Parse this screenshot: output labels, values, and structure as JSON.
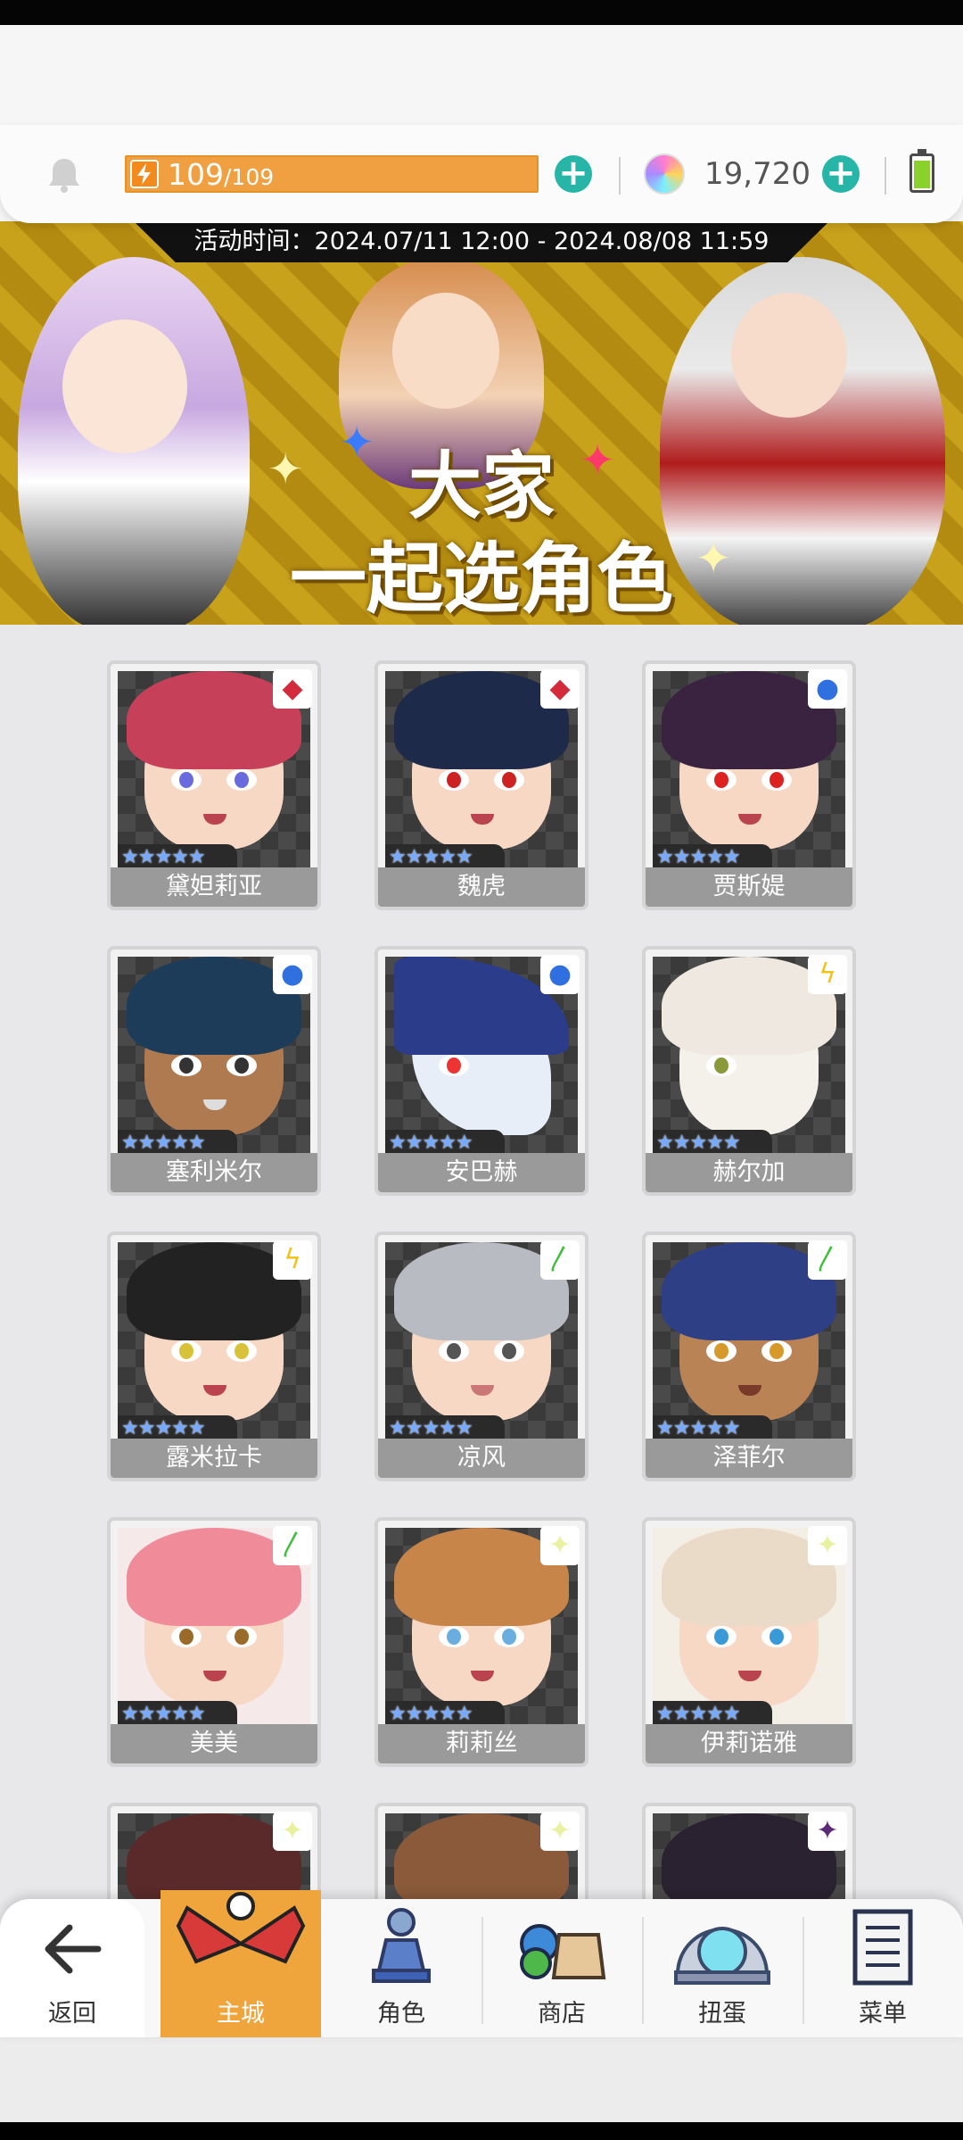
{
  "status": {
    "energy_current": "109",
    "energy_max": "/109",
    "energy_fraction": 1.0,
    "gems": "19,720"
  },
  "banner": {
    "activity_time": "活动时间：2024.07/11 12:00 - 2024.08/08 11:59",
    "title_line1": "大家",
    "title_line2": "一起选角色"
  },
  "characters": [
    {
      "name": "黛妲莉亚",
      "element": "fire-element-icon",
      "stars": "★★★★★"
    },
    {
      "name": "魏虎",
      "element": "fire-element-icon",
      "stars": "★★★★★"
    },
    {
      "name": "贾斯媞",
      "element": "water-element-icon",
      "stars": "★★★★★"
    },
    {
      "name": "塞利米尔",
      "element": "water-element-icon",
      "stars": "★★★★★"
    },
    {
      "name": "安巴赫",
      "element": "water-element-icon",
      "stars": "★★★★★"
    },
    {
      "name": "赫尔加",
      "element": "lightning-element-icon",
      "stars": "★★★★★"
    },
    {
      "name": "露米拉卡",
      "element": "lightning-element-icon",
      "stars": "★★★★★"
    },
    {
      "name": "凉风",
      "element": "wind-element-icon",
      "stars": "★★★★★"
    },
    {
      "name": "泽菲尔",
      "element": "wind-element-icon",
      "stars": "★★★★★"
    },
    {
      "name": "美美",
      "element": "wind-element-icon",
      "stars": "★★★★★"
    },
    {
      "name": "莉莉丝",
      "element": "light-element-icon",
      "stars": "★★★★★"
    },
    {
      "name": "伊莉诺雅",
      "element": "light-element-icon",
      "stars": "★★★★★"
    }
  ],
  "nav": {
    "back": "返回",
    "home": "主城",
    "characters": "角色",
    "shop": "商店",
    "gacha": "扭蛋",
    "menu": "菜单"
  },
  "colors": {
    "accent": "#efa53c",
    "plus": "#27b5a8",
    "name_bg": "#9a9a9a"
  }
}
